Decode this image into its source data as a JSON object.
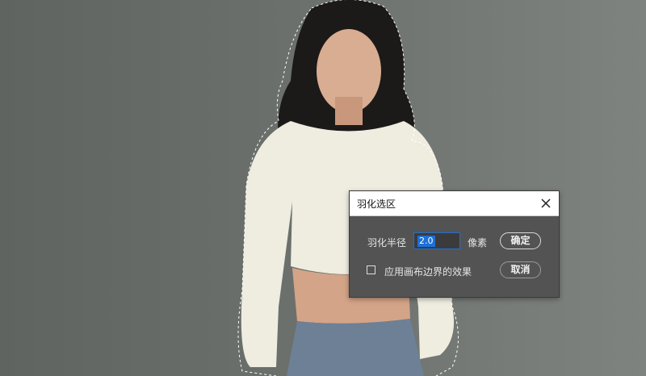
{
  "dialog": {
    "title": "羽化选区",
    "radius_label": "羽化半径",
    "radius_value": "2.0",
    "unit": "像素",
    "ok_label": "确定",
    "cancel_label": "取消",
    "checkbox_label": "应用画布边界的效果",
    "checkbox_checked": false
  },
  "colors": {
    "canvas_left": "#5f6460",
    "canvas_right": "#7f837f",
    "dialog_bg": "#535353",
    "title_bg": "#ffffff",
    "accent": "#1f6fd6",
    "sweater": "#efece0",
    "hair": "#1c1a18",
    "skin": "#d9ad91",
    "jeans": "#6d8096"
  },
  "icons": [
    "close-icon"
  ]
}
